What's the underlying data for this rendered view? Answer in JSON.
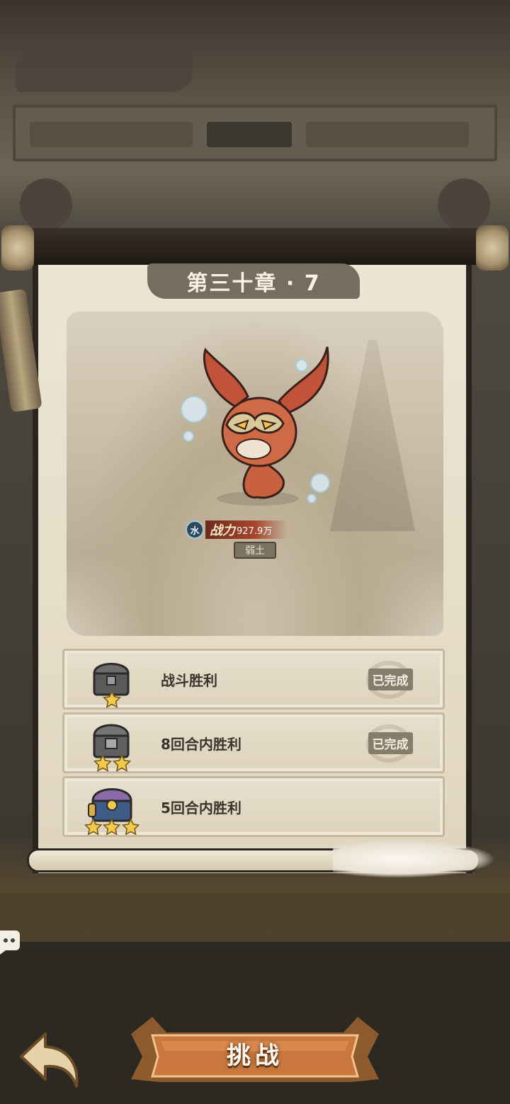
{
  "stage": {
    "title": "第三十章 · 7"
  },
  "enemy": {
    "element_icon_label": "水",
    "power_label": "战力",
    "power_value": "927.9万",
    "class_tag": "弱土"
  },
  "objectives": [
    {
      "label": "战斗胜利",
      "stars": 1,
      "status": "已完成",
      "completed": true
    },
    {
      "label": "8回合内胜利",
      "stars": 2,
      "status": "已完成",
      "completed": true
    },
    {
      "label": "5回合内胜利",
      "stars": 3,
      "status": "",
      "completed": false
    }
  ],
  "actions": {
    "challenge_label": "挑战"
  },
  "icons": {
    "back": "back-arrow-icon",
    "chat": "chat-bubble-icon",
    "star": "star-icon",
    "chest": "treasure-chest-icon"
  },
  "colors": {
    "paper": "#e6ddc8",
    "banner": "#746d60",
    "button": "#c9773e",
    "star": "#f2c94a"
  }
}
